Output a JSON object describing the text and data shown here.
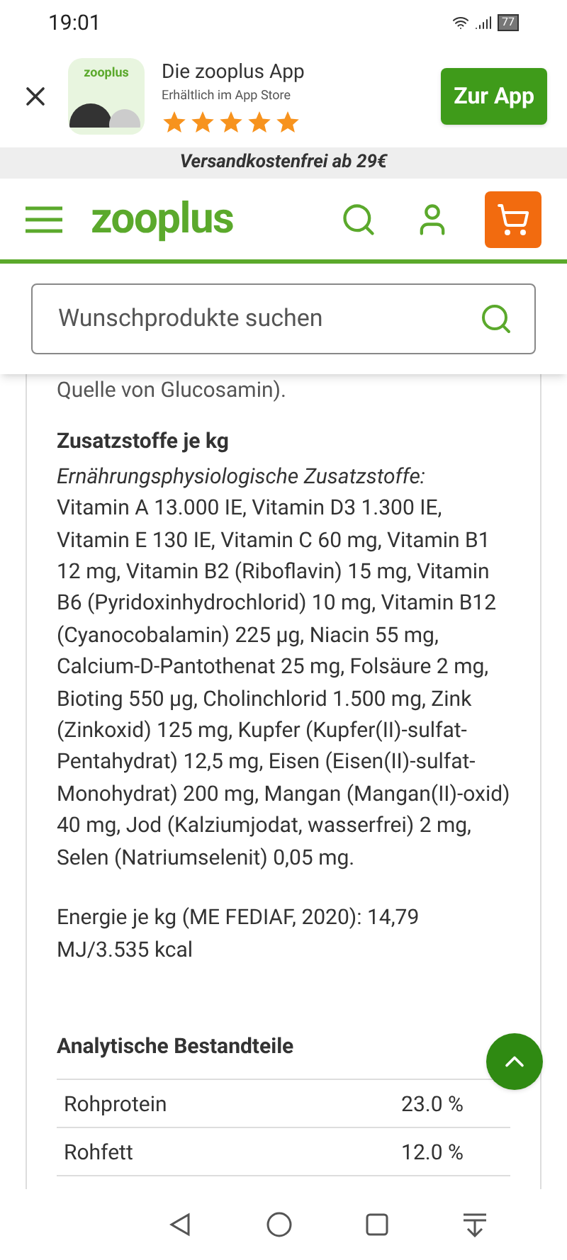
{
  "status_bar": {
    "time": "19:01",
    "battery": "77"
  },
  "app_banner": {
    "icon_label": "zooplus",
    "title": "Die zooplus App",
    "subtitle": "Erhältlich im App Store",
    "stars": 5,
    "button": "Zur App"
  },
  "promo_bar": "Versandkostenfrei ab 29€",
  "header": {
    "logo": "zooplus"
  },
  "search": {
    "placeholder": "Wunschprodukte suchen"
  },
  "content": {
    "cut_line": "Quelle von Glucosamin).",
    "additives_title": "Zusatzstoffe je kg",
    "additives_subtitle": "Ernährungsphysiologische Zusatzstoffe:",
    "additives_text": "Vitamin A 13.000 IE, Vitamin D3 1.300 IE, Vitamin E 130 IE, Vitamin C 60 mg, Vitamin B1 12 mg, Vitamin B2 (Riboflavin) 15 mg, Vitamin B6 (Pyridoxinhydrochlorid) 10 mg, Vitamin B12 (Cyanocobalamin) 225 µg, Niacin 55 mg, Calcium-D-Pantothenat 25 mg, Folsäure 2 mg, Bioting 550 µg, Cholinchlorid 1.500 mg, Zink (Zinkoxid) 125 mg, Kupfer (Kupfer(II)-sulfat-Pentahydrat) 12,5 mg, Eisen (Eisen(II)-sulfat-Monohydrat) 200 mg, Mangan (Mangan(II)-oxid) 40 mg, Jod (Kalziumjodat, wasserfrei) 2 mg, Selen (Natriumselenit) 0,05 mg.",
    "energy": "Energie je kg (ME FEDIAF, 2020): 14,79 MJ/3.535 kcal",
    "analysis_title": "Analytische Bestandteile",
    "analysis_rows": [
      {
        "name": "Rohprotein",
        "value": "23.0 %"
      },
      {
        "name": "Rohfett",
        "value": "12.0 %"
      }
    ]
  }
}
